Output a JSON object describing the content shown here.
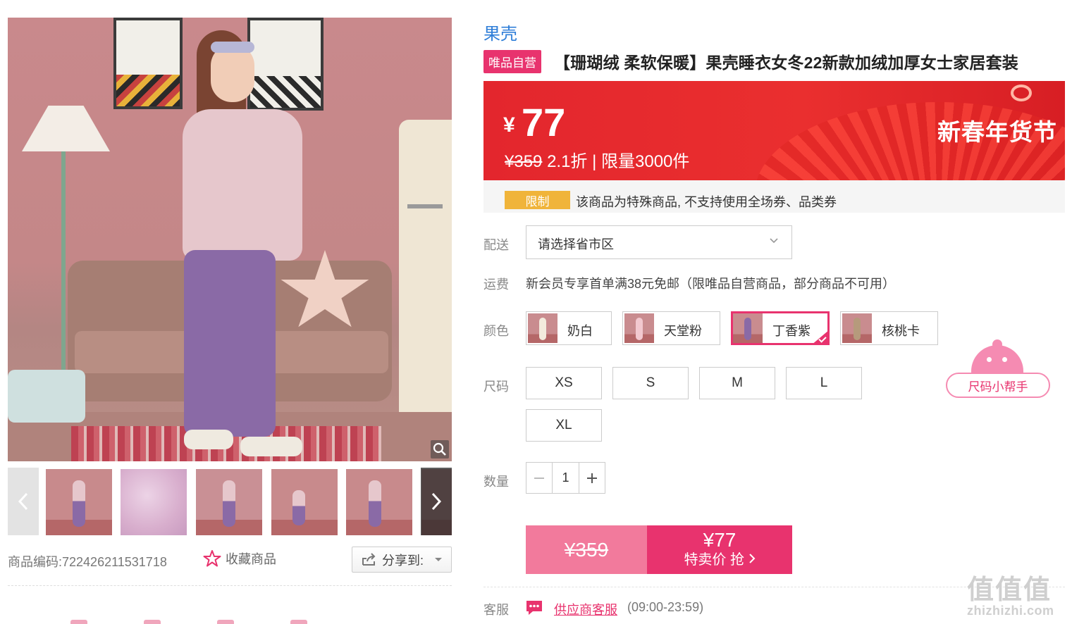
{
  "brand": "果壳",
  "badge": "唯品自营",
  "title": "【珊瑚绒 柔软保暖】果壳睡衣女冬22新款加绒加厚女士家居套装",
  "price": {
    "currency": "¥",
    "current": "77",
    "original": "¥359",
    "discount": "2.1折",
    "separator": "|",
    "limited": "限量3000件",
    "festival": "新春年货节"
  },
  "restriction": {
    "tag": "限制",
    "text": "该商品为特殊商品, 不支持使用全场券、品类券"
  },
  "delivery": {
    "label": "配送",
    "placeholder": "请选择省市区"
  },
  "shipping": {
    "label": "运费",
    "text": "新会员专享首单满38元免邮（限唯品自营商品，部分商品不可用）"
  },
  "colors": {
    "label": "颜色",
    "options": [
      "奶白",
      "天堂粉",
      "丁香紫",
      "核桃卡"
    ],
    "selected": "丁香紫"
  },
  "sizes": {
    "label": "尺码",
    "options": [
      "XS",
      "S",
      "M",
      "L",
      "XL"
    ],
    "helper": "尺码小帮手"
  },
  "quantity": {
    "label": "数量",
    "value": "1"
  },
  "buy": {
    "original": "¥359",
    "price": "¥77",
    "cta": "特卖价 抢"
  },
  "service": {
    "label": "客服",
    "link": "供应商客服",
    "hours": "(09:00-23:59)"
  },
  "product": {
    "code_label": "商品编码:",
    "code": "722426211531718",
    "favorite": "收藏商品",
    "share": "分享到:"
  },
  "watermark": {
    "glyphs": "值值值",
    "url": "zhizhizhi.com"
  },
  "colors_hex": {
    "accent_pink": "#e8336e",
    "banner_red": "#e3262d",
    "brand_blue": "#2f7ed8",
    "restriction_tag": "#f0b43a"
  }
}
